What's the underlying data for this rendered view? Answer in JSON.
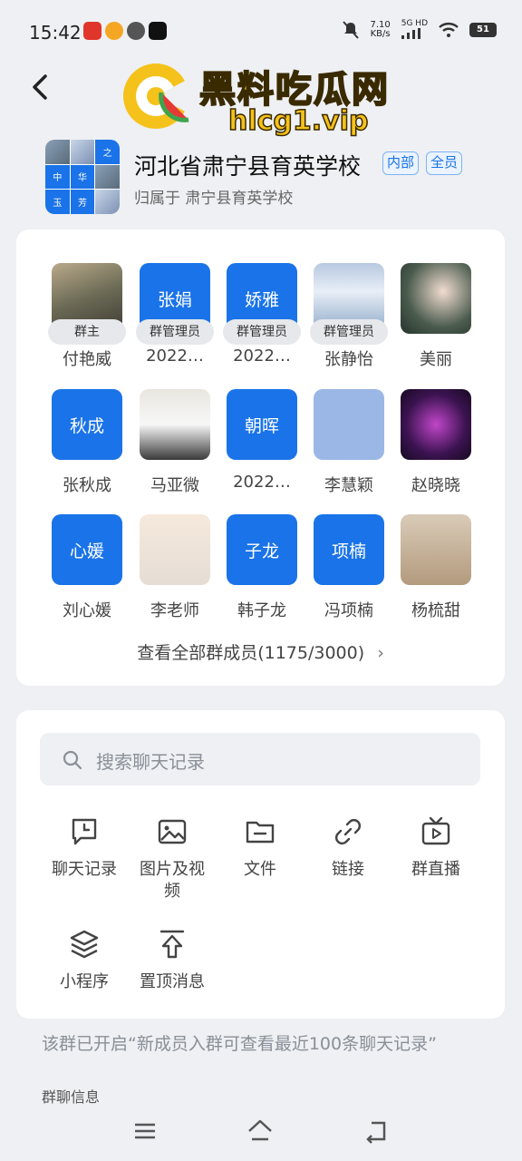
{
  "status": {
    "time": "15:42",
    "speed_top": "7.10",
    "speed_bottom": "KB/s",
    "network_top": "5G HD",
    "battery": "51"
  },
  "watermark": {
    "title": "黑料吃瓜网",
    "url": "hlcg1.vip"
  },
  "group": {
    "name": "河北省肃宁县育英学校",
    "badges": [
      "内部",
      "全员"
    ],
    "belong_prefix": "归属于",
    "belong_org": "肃宁县育英学校",
    "avatar_cells": [
      "之",
      "中",
      "华",
      "玉",
      "芳"
    ]
  },
  "members": [
    {
      "name": "付艳威",
      "role": "群主",
      "avatar_text": ""
    },
    {
      "name": "2022…",
      "role": "群管理员",
      "avatar_text": "张娟"
    },
    {
      "name": "2022…",
      "role": "群管理员",
      "avatar_text": "娇雅"
    },
    {
      "name": "张静怡",
      "role": "群管理员",
      "avatar_text": ""
    },
    {
      "name": "美丽",
      "role": "",
      "avatar_text": ""
    },
    {
      "name": "张秋成",
      "role": "",
      "avatar_text": "秋成"
    },
    {
      "name": "马亚微",
      "role": "",
      "avatar_text": ""
    },
    {
      "name": "2022…",
      "role": "",
      "avatar_text": "朝晖"
    },
    {
      "name": "李慧颖",
      "role": "",
      "avatar_text": ""
    },
    {
      "name": "赵晓晓",
      "role": "",
      "avatar_text": ""
    },
    {
      "name": "刘心媛",
      "role": "",
      "avatar_text": "心媛"
    },
    {
      "name": "李老师",
      "role": "",
      "avatar_text": ""
    },
    {
      "name": "韩子龙",
      "role": "",
      "avatar_text": "子龙"
    },
    {
      "name": "冯项楠",
      "role": "",
      "avatar_text": "项楠"
    },
    {
      "name": "杨梳甜",
      "role": "",
      "avatar_text": ""
    }
  ],
  "view_all_label": "查看全部群成员(1175/3000)",
  "search_placeholder": "搜索聊天记录",
  "tools": [
    {
      "label": "聊天记录",
      "icon": "chat-history-icon"
    },
    {
      "label": "图片及视频",
      "icon": "image-icon"
    },
    {
      "label": "文件",
      "icon": "folder-icon"
    },
    {
      "label": "链接",
      "icon": "link-icon"
    },
    {
      "label": "群直播",
      "icon": "live-tv-icon"
    },
    {
      "label": "小程序",
      "icon": "mini-program-icon"
    },
    {
      "label": "置顶消息",
      "icon": "pin-top-icon"
    }
  ],
  "notice": "该群已开启“新成员入群可查看最近100条聊天记录”",
  "section_title": "群聊信息",
  "colors": {
    "accent": "#1a73e8",
    "background": "#eef0f3",
    "card": "#ffffff"
  }
}
